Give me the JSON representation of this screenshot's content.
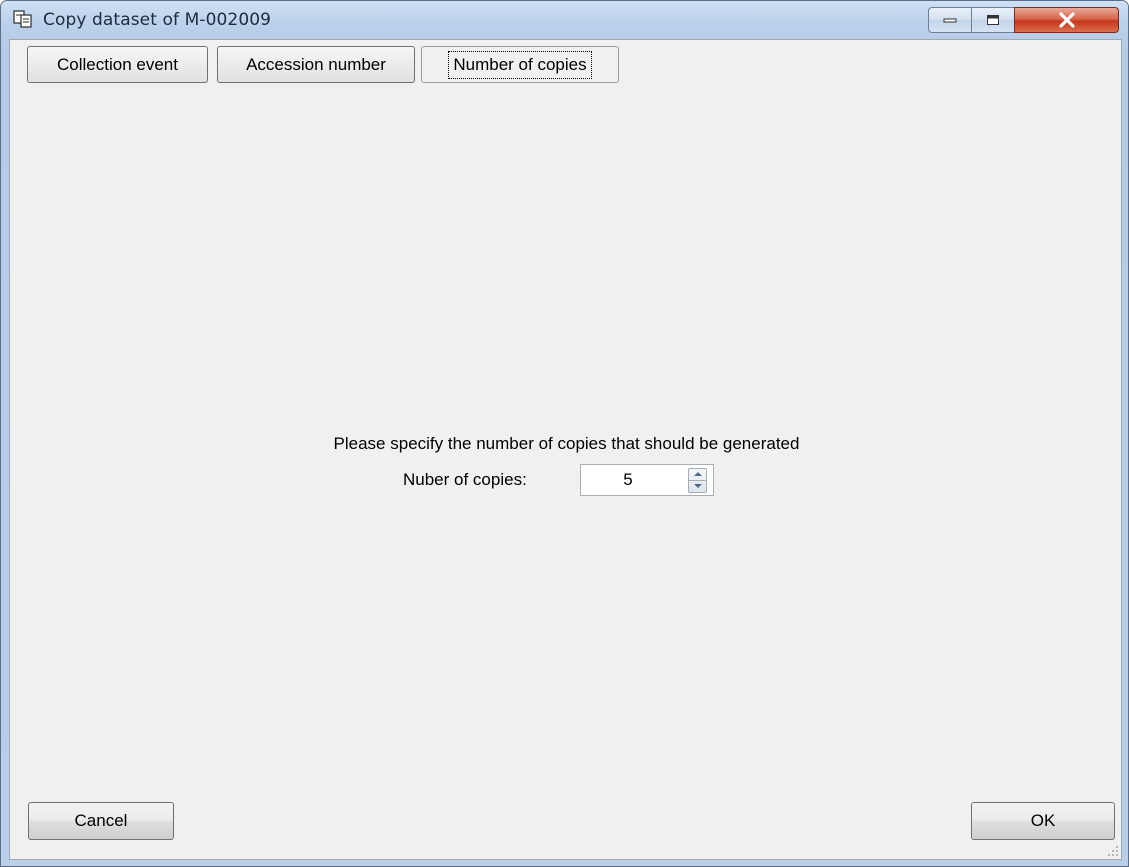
{
  "window": {
    "title": "Copy dataset of M-002009",
    "controls": [
      "minimize-icon",
      "maximize-icon",
      "close-icon"
    ],
    "close_color": "#c7361b"
  },
  "tabs": [
    {
      "label": "Collection event"
    },
    {
      "label": "Accession number"
    },
    {
      "label": "Number of copies",
      "active": true
    }
  ],
  "main": {
    "prompt": "Please specify the number of copies that should be generated",
    "copies_label": "Nuber of copies:",
    "copies_value": "5"
  },
  "footer": {
    "cancel_label": "Cancel",
    "ok_label": "OK"
  }
}
